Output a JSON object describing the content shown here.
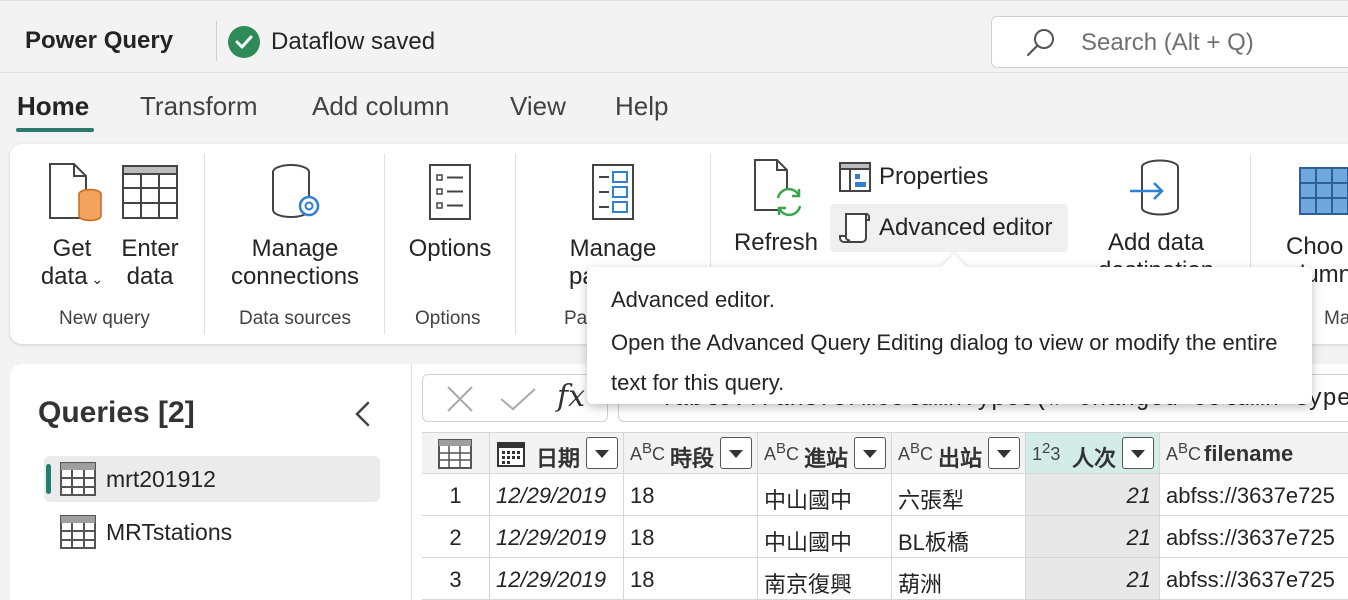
{
  "app": {
    "title": "Power Query",
    "save_status": "Dataflow saved"
  },
  "search": {
    "placeholder": "Search (Alt + Q)"
  },
  "tabs": [
    {
      "label": "Home",
      "active": true
    },
    {
      "label": "Transform"
    },
    {
      "label": "Add column"
    },
    {
      "label": "View"
    },
    {
      "label": "Help"
    }
  ],
  "ribbon": {
    "get_data": "Get",
    "get_data_2": "data",
    "enter_data": "Enter",
    "enter_data_2": "data",
    "manage_connections": "Manage",
    "manage_connections_2": "connections",
    "options": "Options",
    "manage_parameters": "Manage",
    "manage_parameters_2": "param...",
    "refresh": "Refresh",
    "properties": "Properties",
    "advanced_editor": "Advanced editor",
    "add_data_destination": "Add data",
    "add_data_destination_2": "destination",
    "choose_columns": "Choo",
    "choose_columns_2": "lumn",
    "groups": {
      "new_query": "New query",
      "data_sources": "Data sources",
      "options": "Options",
      "parameters": "Pa",
      "manage": "Ma"
    }
  },
  "tooltip": {
    "title": "Advanced editor.",
    "body": "Open the Advanced Query Editing dialog to view or modify the entire text for this query."
  },
  "queries": {
    "title": "Queries [2]",
    "items": [
      {
        "label": "mrt201912",
        "selected": true
      },
      {
        "label": "MRTstations",
        "selected": false
      }
    ]
  },
  "formula": {
    "text": "= Table.TransformColumnTypes(#\"Changed column type\", {{\"filename\", type text}}).Dat"
  },
  "table": {
    "columns": [
      {
        "type_icon": "calendar",
        "label": "日期"
      },
      {
        "type_icon": "ABC",
        "label": "時段"
      },
      {
        "type_icon": "ABC",
        "label": "進站"
      },
      {
        "type_icon": "ABC",
        "label": "出站"
      },
      {
        "type_icon": "123",
        "label": "人次"
      },
      {
        "type_icon": "ABC",
        "label": "filename"
      }
    ],
    "rows": [
      {
        "n": "1",
        "c": [
          "12/29/2019",
          "18",
          "中山國中",
          "六張犁",
          "21",
          "abfss://3637e725"
        ]
      },
      {
        "n": "2",
        "c": [
          "12/29/2019",
          "18",
          "中山國中",
          "BL板橋",
          "21",
          "abfss://3637e725"
        ]
      },
      {
        "n": "3",
        "c": [
          "12/29/2019",
          "18",
          "南京復興",
          "葫洲",
          "21",
          "abfss://3637e725"
        ]
      }
    ]
  }
}
